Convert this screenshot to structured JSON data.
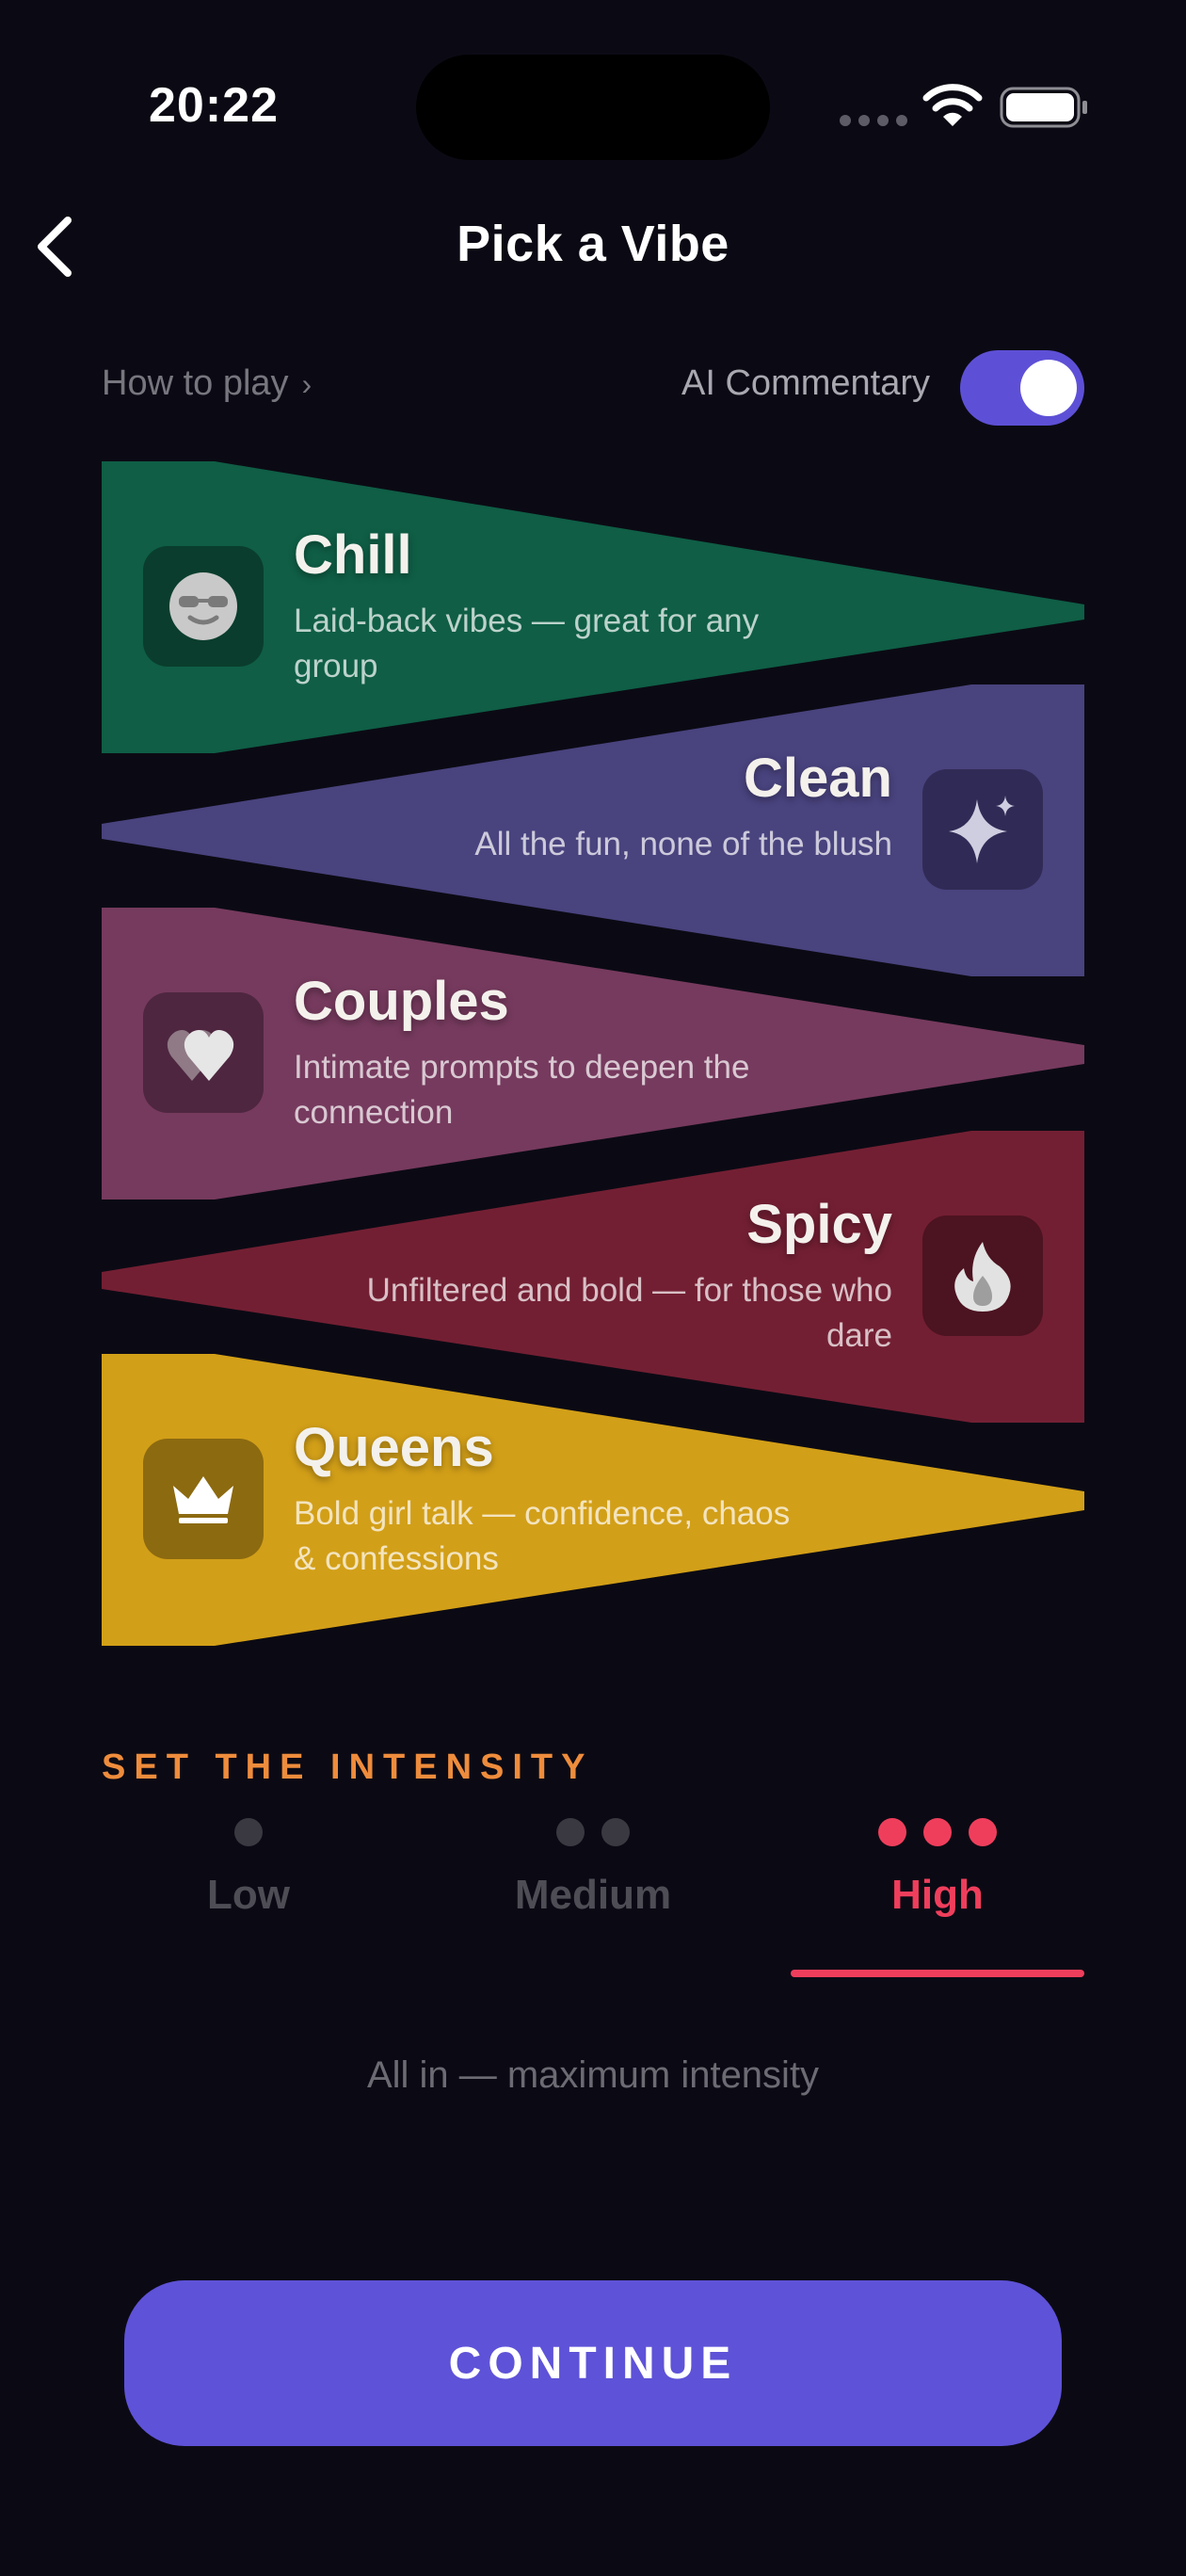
{
  "status_bar": {
    "time": "20:22"
  },
  "header": {
    "title": "Pick a Vibe"
  },
  "controls": {
    "how_to_play": "How to play",
    "how_to_play_chevron": "›",
    "ai_commentary_label": "AI Commentary",
    "ai_commentary_on": true
  },
  "vibes": [
    {
      "name": "Chill",
      "description": "Laid-back vibes — great for any group",
      "icon": "sunglasses-face-icon",
      "color": "#0f5e45",
      "selected": false
    },
    {
      "name": "Clean",
      "description": "All the fun, none of the blush",
      "icon": "sparkle-icon",
      "color": "#49437e",
      "selected": false
    },
    {
      "name": "Couples",
      "description": "Intimate prompts to deepen the connection",
      "icon": "hearts-icon",
      "color": "#763a5e",
      "selected": false
    },
    {
      "name": "Spicy",
      "description": "Unfiltered and bold — for those who dare",
      "icon": "flame-icon",
      "color": "#731f33",
      "selected": false
    },
    {
      "name": "Queens",
      "description": "Bold girl talk — confidence, chaos & confessions",
      "icon": "crown-icon",
      "color": "#d29f18",
      "selected": false
    }
  ],
  "intensity": {
    "label": "SET THE INTENSITY",
    "levels": [
      {
        "name": "Low",
        "dots": 1
      },
      {
        "name": "Medium",
        "dots": 2
      },
      {
        "name": "High",
        "dots": 3
      }
    ],
    "selected": "High",
    "description": "All in — maximum intensity"
  },
  "continue_label": "CONTINUE",
  "colors": {
    "accent": "#5e52d8",
    "intensity_active": "#ef3e5c",
    "section_label": "#ee8c3c"
  }
}
